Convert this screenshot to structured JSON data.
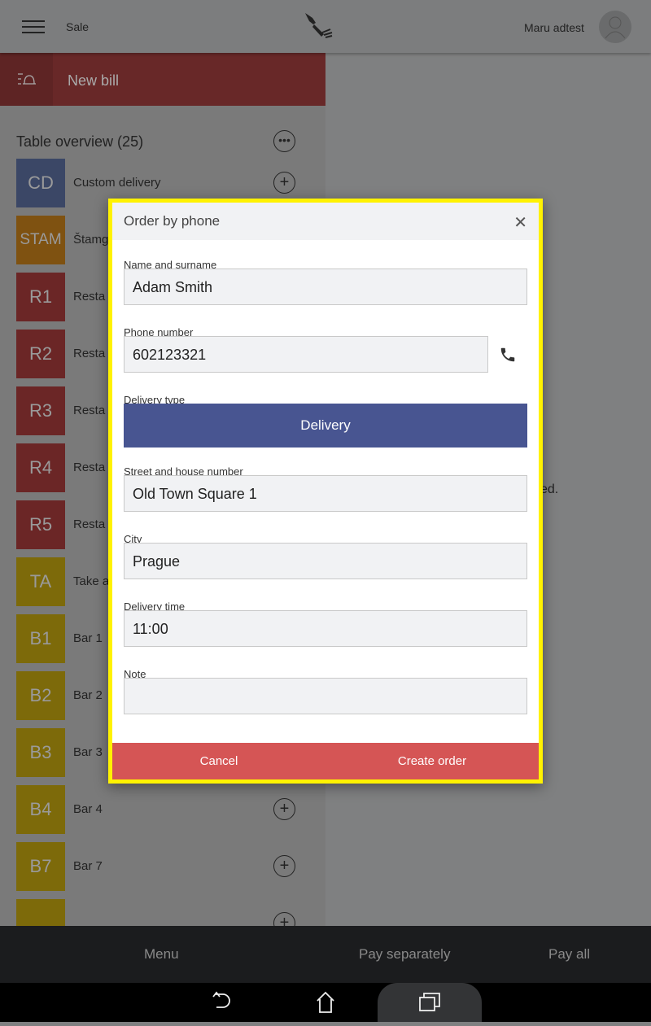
{
  "header": {
    "title": "Sale",
    "user": "Maru adtest"
  },
  "sidebar": {
    "new_bill": "New bill",
    "table_overview": "Table overview (25)",
    "tables": [
      {
        "code": "CD",
        "name": "Custom delivery",
        "color": "#3b4766"
      },
      {
        "code": "STAM",
        "name": "Štamg",
        "color": "#7f5211"
      },
      {
        "code": "R1",
        "name": "Resta",
        "color": "#6b2626"
      },
      {
        "code": "R2",
        "name": "Resta",
        "color": "#6b2626"
      },
      {
        "code": "R3",
        "name": "Resta",
        "color": "#6b2626"
      },
      {
        "code": "R4",
        "name": "Resta",
        "color": "#6b2626"
      },
      {
        "code": "R5",
        "name": "Resta",
        "color": "#6b2626"
      },
      {
        "code": "TA",
        "name": "Take a",
        "color": "#7d6a0a"
      },
      {
        "code": "B1",
        "name": "Bar 1",
        "color": "#7d6a0a"
      },
      {
        "code": "B2",
        "name": "Bar 2",
        "color": "#7d6a0a"
      },
      {
        "code": "B3",
        "name": "Bar 3",
        "color": "#7d6a0a"
      },
      {
        "code": "B4",
        "name": "Bar 4",
        "color": "#7d6a0a"
      },
      {
        "code": "B7",
        "name": "Bar 7",
        "color": "#7d6a0a"
      },
      {
        "code": "",
        "name": "",
        "color": "#7d6a0a"
      }
    ]
  },
  "main": {
    "partial_text": "ed."
  },
  "bottom_bar": {
    "menu": "Menu",
    "pay_separately": "Pay separately",
    "pay_all": "Pay all"
  },
  "dialog": {
    "title": "Order by phone",
    "name_label": "Name and surname",
    "name_value": "Adam Smith",
    "phone_label": "Phone number",
    "phone_value": "602123321",
    "delivery_type_label": "Delivery type",
    "delivery_type_value": "Delivery",
    "street_label": "Street and house number",
    "street_value": "Old Town Square 1",
    "city_label": "City",
    "city_value": "Prague",
    "time_label": "Delivery time",
    "time_value": "11:00",
    "note_label": "Note",
    "note_value": "",
    "cancel": "Cancel",
    "create": "Create order"
  },
  "colors": {
    "highlight": "#fff200",
    "delivery_button": "#485591",
    "footer": "#d55555"
  }
}
